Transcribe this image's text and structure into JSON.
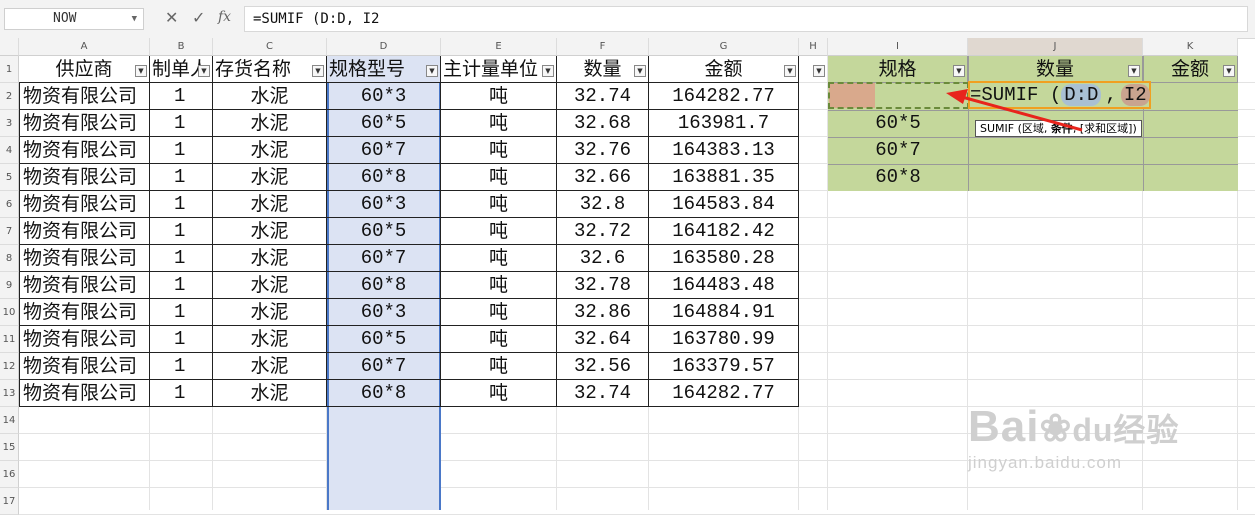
{
  "name_box": {
    "value": "NOW"
  },
  "formula_bar": {
    "value": "=SUMIF (D:D, I2"
  },
  "icons": [
    "cancel-icon",
    "confirm-icon",
    "fx-icon",
    "filter-icon"
  ],
  "columns": [
    "A",
    "B",
    "C",
    "D",
    "E",
    "F",
    "G",
    "H",
    "I",
    "J",
    "K"
  ],
  "rows": [
    "1",
    "2",
    "3",
    "4",
    "5",
    "6",
    "7",
    "8",
    "9",
    "10",
    "11",
    "12",
    "13",
    "14",
    "15",
    "16",
    "17"
  ],
  "table_headers": [
    "供应商",
    "制单人",
    "存货名称",
    "规格型号",
    "主计量单位",
    "数量",
    "金额"
  ],
  "table_rows": [
    [
      "物资有限公司",
      "1",
      "水泥",
      "60*3",
      "吨",
      "32.74",
      "164282.77"
    ],
    [
      "物资有限公司",
      "1",
      "水泥",
      "60*5",
      "吨",
      "32.68",
      "163981.7"
    ],
    [
      "物资有限公司",
      "1",
      "水泥",
      "60*7",
      "吨",
      "32.76",
      "164383.13"
    ],
    [
      "物资有限公司",
      "1",
      "水泥",
      "60*8",
      "吨",
      "32.66",
      "163881.35"
    ],
    [
      "物资有限公司",
      "1",
      "水泥",
      "60*3",
      "吨",
      "32.8",
      "164583.84"
    ],
    [
      "物资有限公司",
      "1",
      "水泥",
      "60*5",
      "吨",
      "32.72",
      "164182.42"
    ],
    [
      "物资有限公司",
      "1",
      "水泥",
      "60*7",
      "吨",
      "32.6",
      "163580.28"
    ],
    [
      "物资有限公司",
      "1",
      "水泥",
      "60*8",
      "吨",
      "32.78",
      "164483.48"
    ],
    [
      "物资有限公司",
      "1",
      "水泥",
      "60*3",
      "吨",
      "32.86",
      "164884.91"
    ],
    [
      "物资有限公司",
      "1",
      "水泥",
      "60*5",
      "吨",
      "32.64",
      "163780.99"
    ],
    [
      "物资有限公司",
      "1",
      "水泥",
      "60*7",
      "吨",
      "32.56",
      "163379.57"
    ],
    [
      "物资有限公司",
      "1",
      "水泥",
      "60*8",
      "吨",
      "32.74",
      "164282.77"
    ]
  ],
  "summary_headers": [
    "规格",
    "数量",
    "金额"
  ],
  "summary_specs": [
    "",
    "60*5",
    "60*7",
    "60*8"
  ],
  "summary_formula": {
    "prefix": "=SUMIF (",
    "range": "D:D",
    "sep": ",",
    "ref": "I2"
  },
  "tooltip": {
    "prefix": "SUMIF (区域, ",
    "bold": "条件",
    "suffix": ", [求和区域])"
  },
  "watermark": {
    "brand": "Bai",
    "brand2": "经验",
    "url": "jingyan.baidu.com"
  },
  "colors": {
    "green": "#c4d79b",
    "selected_column": "#dce3f3",
    "arrow": "#e8241c",
    "active_cell": "#d9a98c"
  }
}
